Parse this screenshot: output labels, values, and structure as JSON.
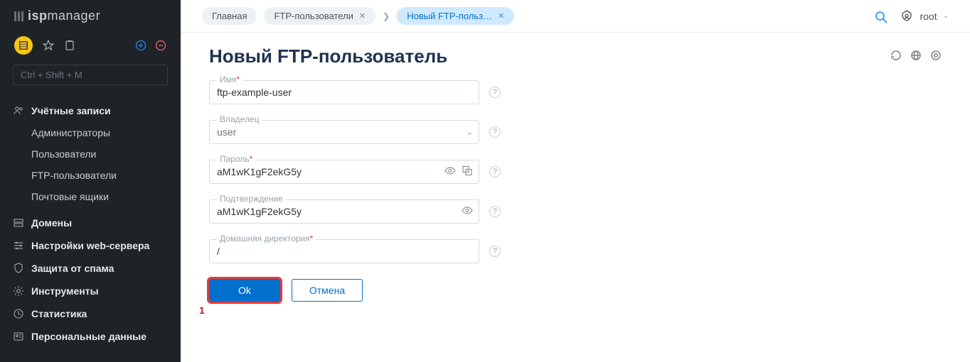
{
  "logo": {
    "text1": "isp",
    "text2": "manager"
  },
  "search_placeholder": "Ctrl + Shift + M",
  "sidebar": {
    "sections": [
      {
        "title": "Учётные записи",
        "items": [
          "Администраторы",
          "Пользователи",
          "FTP-пользователи",
          "Почтовые ящики"
        ]
      },
      {
        "title": "Домены"
      },
      {
        "title": "Настройки web-сервера"
      },
      {
        "title": "Защита от спама"
      },
      {
        "title": "Инструменты"
      },
      {
        "title": "Статистика"
      },
      {
        "title": "Персональные данные"
      }
    ]
  },
  "breadcrumbs": [
    {
      "label": "Главная",
      "closable": false
    },
    {
      "label": "FTP-пользователи",
      "closable": true
    },
    {
      "label": "Новый FTP-польз…",
      "closable": true,
      "active": true
    }
  ],
  "user": "root",
  "page_title": "Новый FTP-пользователь",
  "form": {
    "name": {
      "label": "Имя",
      "required": true,
      "value": "ftp-example-user"
    },
    "owner": {
      "label": "Владелец",
      "value": "user",
      "type": "select"
    },
    "password": {
      "label": "Пароль",
      "required": true,
      "value": "aM1wK1gF2ekG5y"
    },
    "confirm": {
      "label": "Подтверждение",
      "value": "aM1wK1gF2ekG5y"
    },
    "homedir": {
      "label": "Домашняя директория",
      "required": true,
      "value": "/"
    }
  },
  "buttons": {
    "ok": "Ok",
    "cancel": "Отмена"
  },
  "callout": "1"
}
